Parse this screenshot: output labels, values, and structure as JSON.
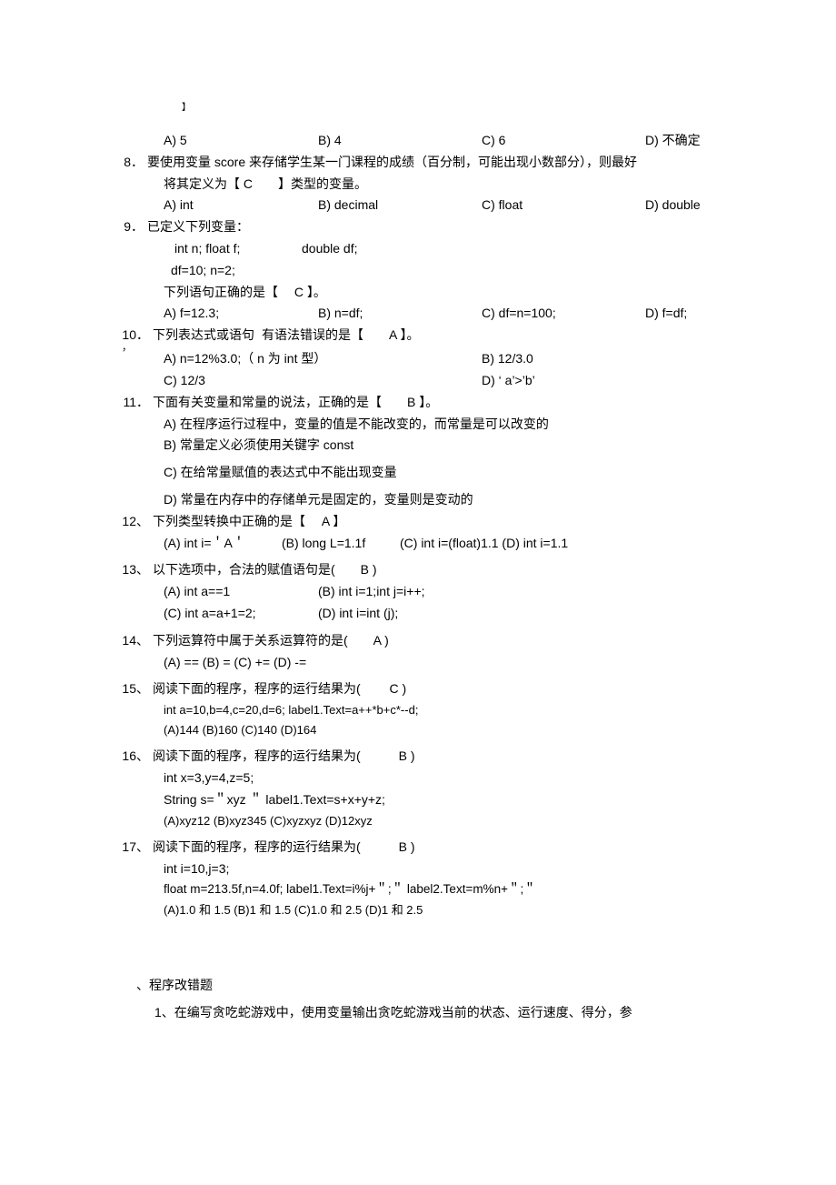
{
  "stray_bracket": "】",
  "q7_opts": {
    "a": "A) 5",
    "b": "B) 4",
    "c": "C) 6",
    "d": "D) 不确定"
  },
  "q8": {
    "num": "8．",
    "text_a": "要使用变量  score 来存储学生某一门课程的成绩（百分制，可能出现小数部分），则最好",
    "text_b": "将其定义为【  C　　】类型的变量。",
    "opts": {
      "a": "A) int",
      "b": "B) decimal",
      "c": "C) float",
      "d": "D) double"
    }
  },
  "q9": {
    "num": "9．",
    "text": "已定义下列变量：",
    "l1a": "int n; float f;",
    "l1b": "double df;",
    "l2": "df=10; n=2;",
    "l3": "下列语句正确的是【　 C 】。",
    "opts": {
      "a": "A) f=12.3;",
      "b": "B) n=df;",
      "c": "C) df=n=100;",
      "d": "D) f=df;"
    }
  },
  "q10": {
    "num": "10．",
    "apos": "，",
    "text_a": "下列表达式或语句",
    "text_b": "有语法错误的是【　　A 】。",
    "opts": {
      "a": "A) n=12%3.0;（ n 为  int 型）",
      "b": "B) 12/3.0",
      "c": "C) 12/3",
      "d": "D) ‘ a’>’b’"
    }
  },
  "q11": {
    "num": "11．",
    "text": "下面有关变量和常量的说法，正确的是【　　B 】。",
    "a": "A)  在程序运行过程中，变量的值是不能改变的，而常量是可以改变的",
    "b": "B)  常量定义必须使用关键字  const",
    "c": "C)  在给常量赋值的表达式中不能出现变量",
    "d": "D)  常量在内存中的存储单元是固定的，变量则是变动的"
  },
  "q12": {
    "num": "12、",
    "text": "下列类型转换中正确的是【　  A  】",
    "a": "(A) int i=＇A＇",
    "b": "(B) long L=1.1f",
    "c": "(C) int i=(float)1.1 (D) int i=1.1"
  },
  "q13": {
    "num": "13、",
    "text": "以下选项中，合法的赋值语句是(　　B  )",
    "a": "(A) int a==1",
    "b": "(B) int i=1;int j=i++;",
    "c": "(C) int a=a+1=2;",
    "d": "(D) int i=int (j);"
  },
  "q14": {
    "num": "14、",
    "text": "下列运算符中属于关系运算符的是(　　A  )",
    "opts": "(A) == (B) = (C) += (D) -="
  },
  "q15": {
    "num": "15、",
    "text": "阅读下面的程序，程序的运行结果为(　　  C  )",
    "code": "int a=10,b=4,c=20,d=6;  label1.Text=a++*b+c*--d;",
    "opts": "(A)144 (B)160 (C)140 (D)164"
  },
  "q16": {
    "num": "16、",
    "text": "阅读下面的程序，程序的运行结果为(　　　B  )",
    "code1": "int x=3,y=4,z=5;",
    "code2": "String s=＂xyz ＂   label1.Text=s+x+y+z;",
    "opts": "(A)xyz12 (B)xyz345 (C)xyzxyz (D)12xyz"
  },
  "q17": {
    "num": "17、",
    "text": "阅读下面的程序，程序的运行结果为(　　　B  )",
    "code1": "int i=10,j=3;",
    "code2": "float m=213.5f,n=4.0f;  label1.Text=i%j+＂;＂  label2.Text=m%n+＂;＂",
    "opts": "(A)1.0 和  1.5 (B)1 和  1.5 (C)1.0 和  2.5 (D)1 和  2.5"
  },
  "section2": {
    "title": "、程序改错题",
    "q1": "1、在编写贪吃蛇游戏中，使用变量输出贪吃蛇游戏当前的状态、运行速度、得分，参"
  }
}
